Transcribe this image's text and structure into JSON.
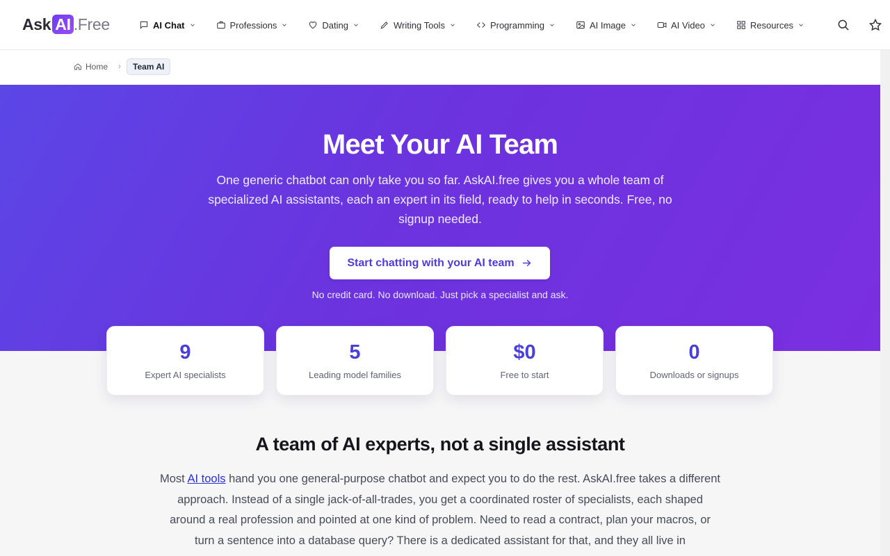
{
  "logo": {
    "ask": "Ask",
    "ai": "AI",
    "free": ".Free"
  },
  "nav": [
    {
      "label": "AI Chat",
      "icon": "chat-bubble-icon"
    },
    {
      "label": "Professions",
      "icon": "briefcase-icon"
    },
    {
      "label": "Dating",
      "icon": "heart-icon"
    },
    {
      "label": "Writing Tools",
      "icon": "pencil-icon"
    },
    {
      "label": "Programming",
      "icon": "code-icon"
    },
    {
      "label": "AI Image",
      "icon": "image-icon"
    },
    {
      "label": "AI Video",
      "icon": "video-icon"
    },
    {
      "label": "Resources",
      "icon": "grid-icon"
    }
  ],
  "breadcrumb": {
    "home": "Home",
    "separator": "›",
    "current": "Team AI"
  },
  "hero": {
    "title": "Meet Your AI Team",
    "subtitle": "One generic chatbot can only take you so far. AskAI.free gives you a whole team of specialized AI assistants, each an expert in its field, ready to help in seconds. Free, no signup needed.",
    "cta": "Start chatting with your AI team",
    "note": "No credit card. No download. Just pick a specialist and ask."
  },
  "stats": [
    {
      "value": "9",
      "label": "Expert AI specialists"
    },
    {
      "value": "5",
      "label": "Leading model families"
    },
    {
      "value": "$0",
      "label": "Free to start"
    },
    {
      "value": "0",
      "label": "Downloads or signups"
    }
  ],
  "section": {
    "title": "A team of AI experts, not a single assistant",
    "body_before": "Most ",
    "link": "AI tools",
    "body_after": " hand you one general-purpose chatbot and expect you to do the rest. AskAI.free takes a different approach. Instead of a single jack-of-all-trades, you get a coordinated roster of specialists, each shaped around a real profession and pointed at one kind of problem. Need to read a contract, plan your macros, or turn a sentence into a database query? There is a dedicated assistant for that, and they all live in"
  },
  "colors": {
    "hero_start": "#5b46e6",
    "hero_end": "#7a2fe0",
    "accent": "#4a3fd6"
  }
}
